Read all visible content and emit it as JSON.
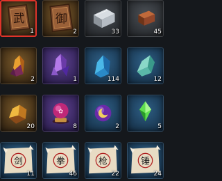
{
  "inventory": {
    "slots": [
      {
        "icon": "martial-token-icon",
        "rarity": "orange",
        "qty": "1",
        "glyph": "武",
        "selected": true
      },
      {
        "icon": "defense-token-icon",
        "rarity": "orange",
        "qty": "2",
        "glyph": "御",
        "selected": false
      },
      {
        "icon": "silver-ingot-icon",
        "rarity": "gray",
        "qty": "33",
        "selected": false
      },
      {
        "icon": "copper-brick-icon",
        "rarity": "gray",
        "qty": "45",
        "selected": false
      },
      {
        "icon": "orange-ore-icon",
        "rarity": "orange",
        "qty": "2",
        "selected": false
      },
      {
        "icon": "purple-crystal-icon",
        "rarity": "purple",
        "qty": "1",
        "selected": false
      },
      {
        "icon": "blue-crystal-icon",
        "rarity": "blue",
        "qty": "114",
        "selected": false
      },
      {
        "icon": "teal-crystal-icon",
        "rarity": "blue",
        "qty": "12",
        "selected": false
      },
      {
        "icon": "gold-ore-icon",
        "rarity": "orange",
        "qty": "20",
        "selected": false
      },
      {
        "icon": "purple-orb-icon",
        "rarity": "purple",
        "qty": "8",
        "selected": false
      },
      {
        "icon": "moon-orb-icon",
        "rarity": "blue",
        "qty": "2",
        "selected": false
      },
      {
        "icon": "green-crystal-icon",
        "rarity": "blue",
        "qty": "5",
        "selected": false
      },
      {
        "icon": "sword-scroll-icon",
        "rarity": "blue",
        "qty": "11",
        "glyph": "剑",
        "selected": false
      },
      {
        "icon": "fist-scroll-icon",
        "rarity": "blue",
        "qty": "46",
        "glyph": "拳",
        "selected": false
      },
      {
        "icon": "spear-scroll-icon",
        "rarity": "blue",
        "qty": "22",
        "glyph": "枪",
        "selected": false
      },
      {
        "icon": "hammer-scroll-icon",
        "rarity": "blue",
        "qty": "24",
        "glyph": "锤",
        "selected": false
      }
    ]
  },
  "colors": {
    "selected_border": "#e0342a",
    "orange_rarity": "#3e2c16",
    "gray_rarity": "#2a2d31",
    "purple_rarity": "#34245a",
    "blue_rarity": "#1a3852"
  }
}
